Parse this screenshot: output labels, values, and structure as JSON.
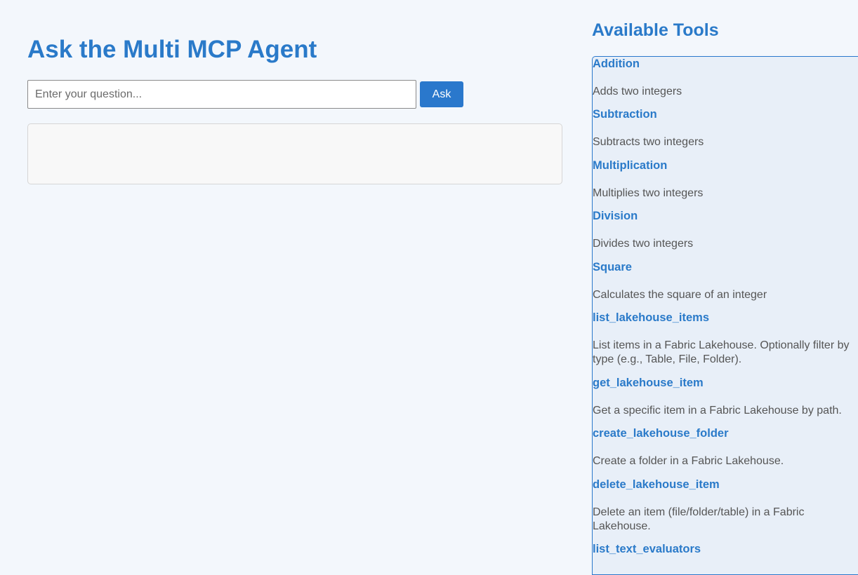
{
  "main": {
    "title": "Ask the Multi MCP Agent",
    "question_placeholder": "Enter your question...",
    "question_value": "",
    "ask_label": "Ask",
    "answer": ""
  },
  "sidebar": {
    "title": "Available Tools",
    "tools": [
      {
        "name": "Addition",
        "description": "Adds two integers"
      },
      {
        "name": "Subtraction",
        "description": "Subtracts two integers"
      },
      {
        "name": "Multiplication",
        "description": "Multiplies two integers"
      },
      {
        "name": "Division",
        "description": "Divides two integers"
      },
      {
        "name": "Square",
        "description": "Calculates the square of an integer"
      },
      {
        "name": "list_lakehouse_items",
        "description": "List items in a Fabric Lakehouse. Optionally filter by type (e.g., Table, File, Folder)."
      },
      {
        "name": "get_lakehouse_item",
        "description": "Get a specific item in a Fabric Lakehouse by path."
      },
      {
        "name": "create_lakehouse_folder",
        "description": "Create a folder in a Fabric Lakehouse."
      },
      {
        "name": "delete_lakehouse_item",
        "description": "Delete an item (file/folder/table) in a Fabric Lakehouse."
      },
      {
        "name": "list_text_evaluators",
        "description": ""
      }
    ]
  },
  "colors": {
    "accent": "#2a7ac9",
    "button": "#2a78cc",
    "page_background": "#f3f7fc",
    "panel_background": "#e8eff8"
  }
}
